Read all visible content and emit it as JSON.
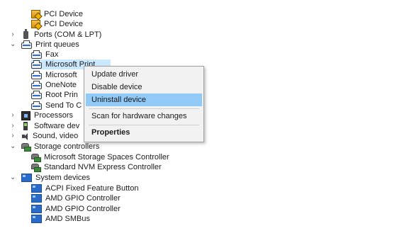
{
  "tree": {
    "pci_1": "PCI Device",
    "pci_2": "PCI Device",
    "ports": "Ports (COM & LPT)",
    "print_queues": "Print queues",
    "fax": "Fax",
    "ms_print": "Microsoft Print",
    "ms_xps": "Microsoft",
    "onenote": "OneNote",
    "root_print": "Root Prin",
    "send_to": "Send To C",
    "processors": "Processors",
    "software_dev": "Software dev",
    "sound": "Sound, video",
    "storage_controllers": "Storage controllers",
    "ms_storage_spaces": "Microsoft Storage Spaces Controller",
    "nvme": "Standard NVM Express Controller",
    "system_devices": "System devices",
    "acpi_fixed": "ACPI Fixed Feature Button",
    "gpio_1": "AMD GPIO Controller",
    "gpio_2": "AMD GPIO Controller",
    "smbus": "AMD SMBus"
  },
  "context_menu": {
    "update_driver": "Update driver",
    "disable_device": "Disable device",
    "uninstall_device": "Uninstall device",
    "scan_hardware": "Scan for hardware changes",
    "properties": "Properties"
  },
  "icons": {
    "expand": "chevron-right-icon",
    "collapse": "chevron-down-icon"
  },
  "colors": {
    "selection": "#cce8ff",
    "menu_hover": "#91c9f7",
    "menu_bg": "#f2f2f2"
  }
}
